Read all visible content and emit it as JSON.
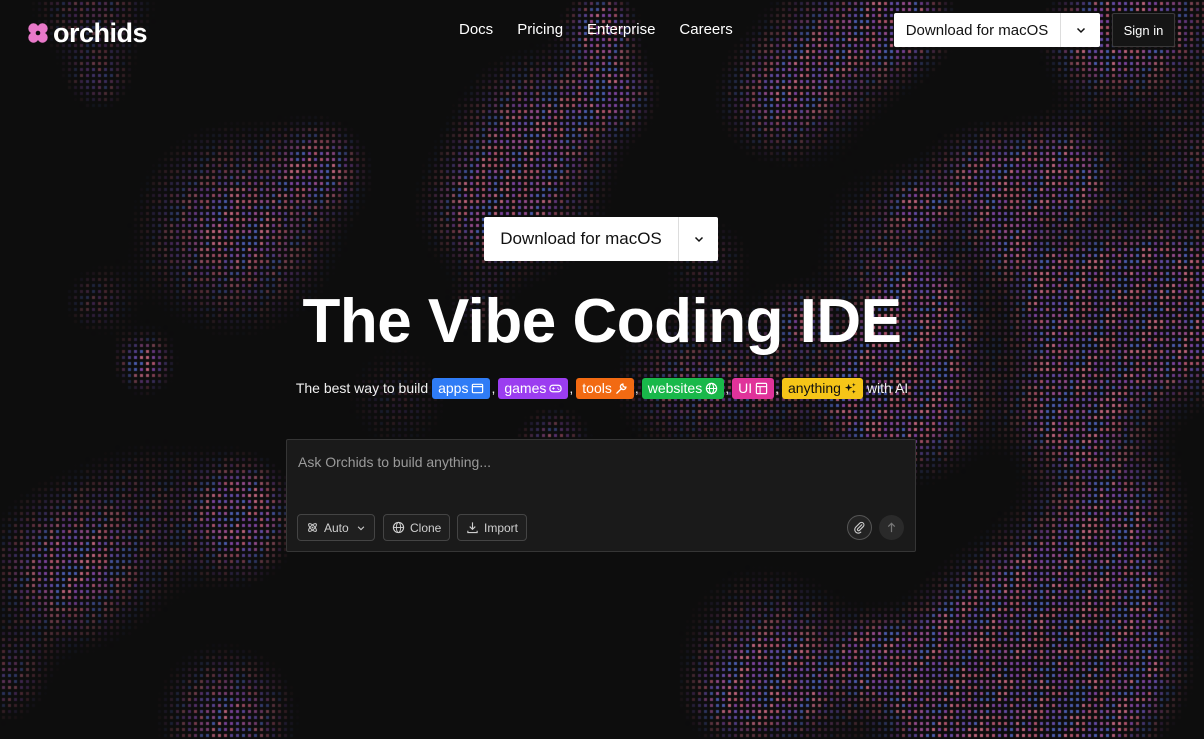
{
  "brand": {
    "name": "orchids"
  },
  "nav": {
    "items": [
      "Docs",
      "Pricing",
      "Enterprise",
      "Careers"
    ]
  },
  "header": {
    "download_label": "Download for macOS",
    "signin_label": "Sign in"
  },
  "hero": {
    "download_label": "Download for macOS",
    "title": "The Vibe Coding IDE",
    "subtitle_prefix": "The best way to build",
    "subtitle_suffix": "with AI",
    "tags": [
      {
        "label": "apps",
        "icon": "window-icon",
        "color": "#2f7cf6"
      },
      {
        "label": "games",
        "icon": "gamepad-icon",
        "color": "#9b3df0"
      },
      {
        "label": "tools",
        "icon": "wrench-icon",
        "color": "#f26a12"
      },
      {
        "label": "websites",
        "icon": "globe-icon",
        "color": "#19b84a"
      },
      {
        "label": "UI",
        "icon": "layout-icon",
        "color": "#e0339a"
      },
      {
        "label": "anything",
        "icon": "sparkles-icon",
        "color": "#f5c518"
      }
    ]
  },
  "prompt": {
    "placeholder": "Ask Orchids to build anything...",
    "mode_label": "Auto",
    "clone_label": "Clone",
    "import_label": "Import"
  },
  "colors": {
    "background": "#0d0d0d",
    "logo": "#e879c9",
    "panel": "#1a1a1a"
  }
}
